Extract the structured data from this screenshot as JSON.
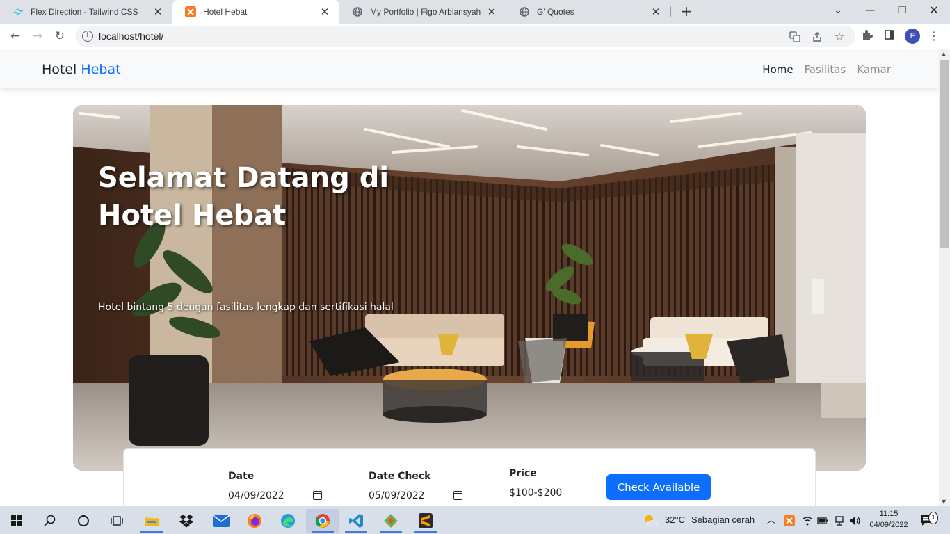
{
  "browser": {
    "tabs": [
      {
        "title": "Flex Direction - Tailwind CSS",
        "active": false
      },
      {
        "title": "Hotel Hebat",
        "active": true
      },
      {
        "title": "My Portfolio | Figo Arbiansyah",
        "active": false
      },
      {
        "title": "G' Quotes",
        "active": false
      }
    ],
    "url": "localhost/hotel/",
    "profile_initial": "F"
  },
  "site": {
    "brand_primary": "Hotel",
    "brand_accent": "Hebat",
    "nav": [
      {
        "label": "Home",
        "active": true
      },
      {
        "label": "Fasilitas",
        "active": false
      },
      {
        "label": "Kamar",
        "active": false
      }
    ],
    "accent_color": "#0d6efd"
  },
  "hero": {
    "title": "Selamat Datang di Hotel Hebat",
    "subtitle": "Hotel bintang 5 dengan fasilitas lengkap dan sertifikasi halal"
  },
  "booking": {
    "date_label": "Date",
    "date_value": "04/09/2022",
    "date_check_label": "Date Check",
    "date_check_value": "05/09/2022",
    "price_label": "Price",
    "price_value": "$100-$200",
    "button_label": "Check Available"
  },
  "taskbar": {
    "weather_temp": "32°C",
    "weather_desc": "Sebagian cerah",
    "time": "11:15",
    "date": "04/09/2022",
    "notification_count": "1"
  }
}
